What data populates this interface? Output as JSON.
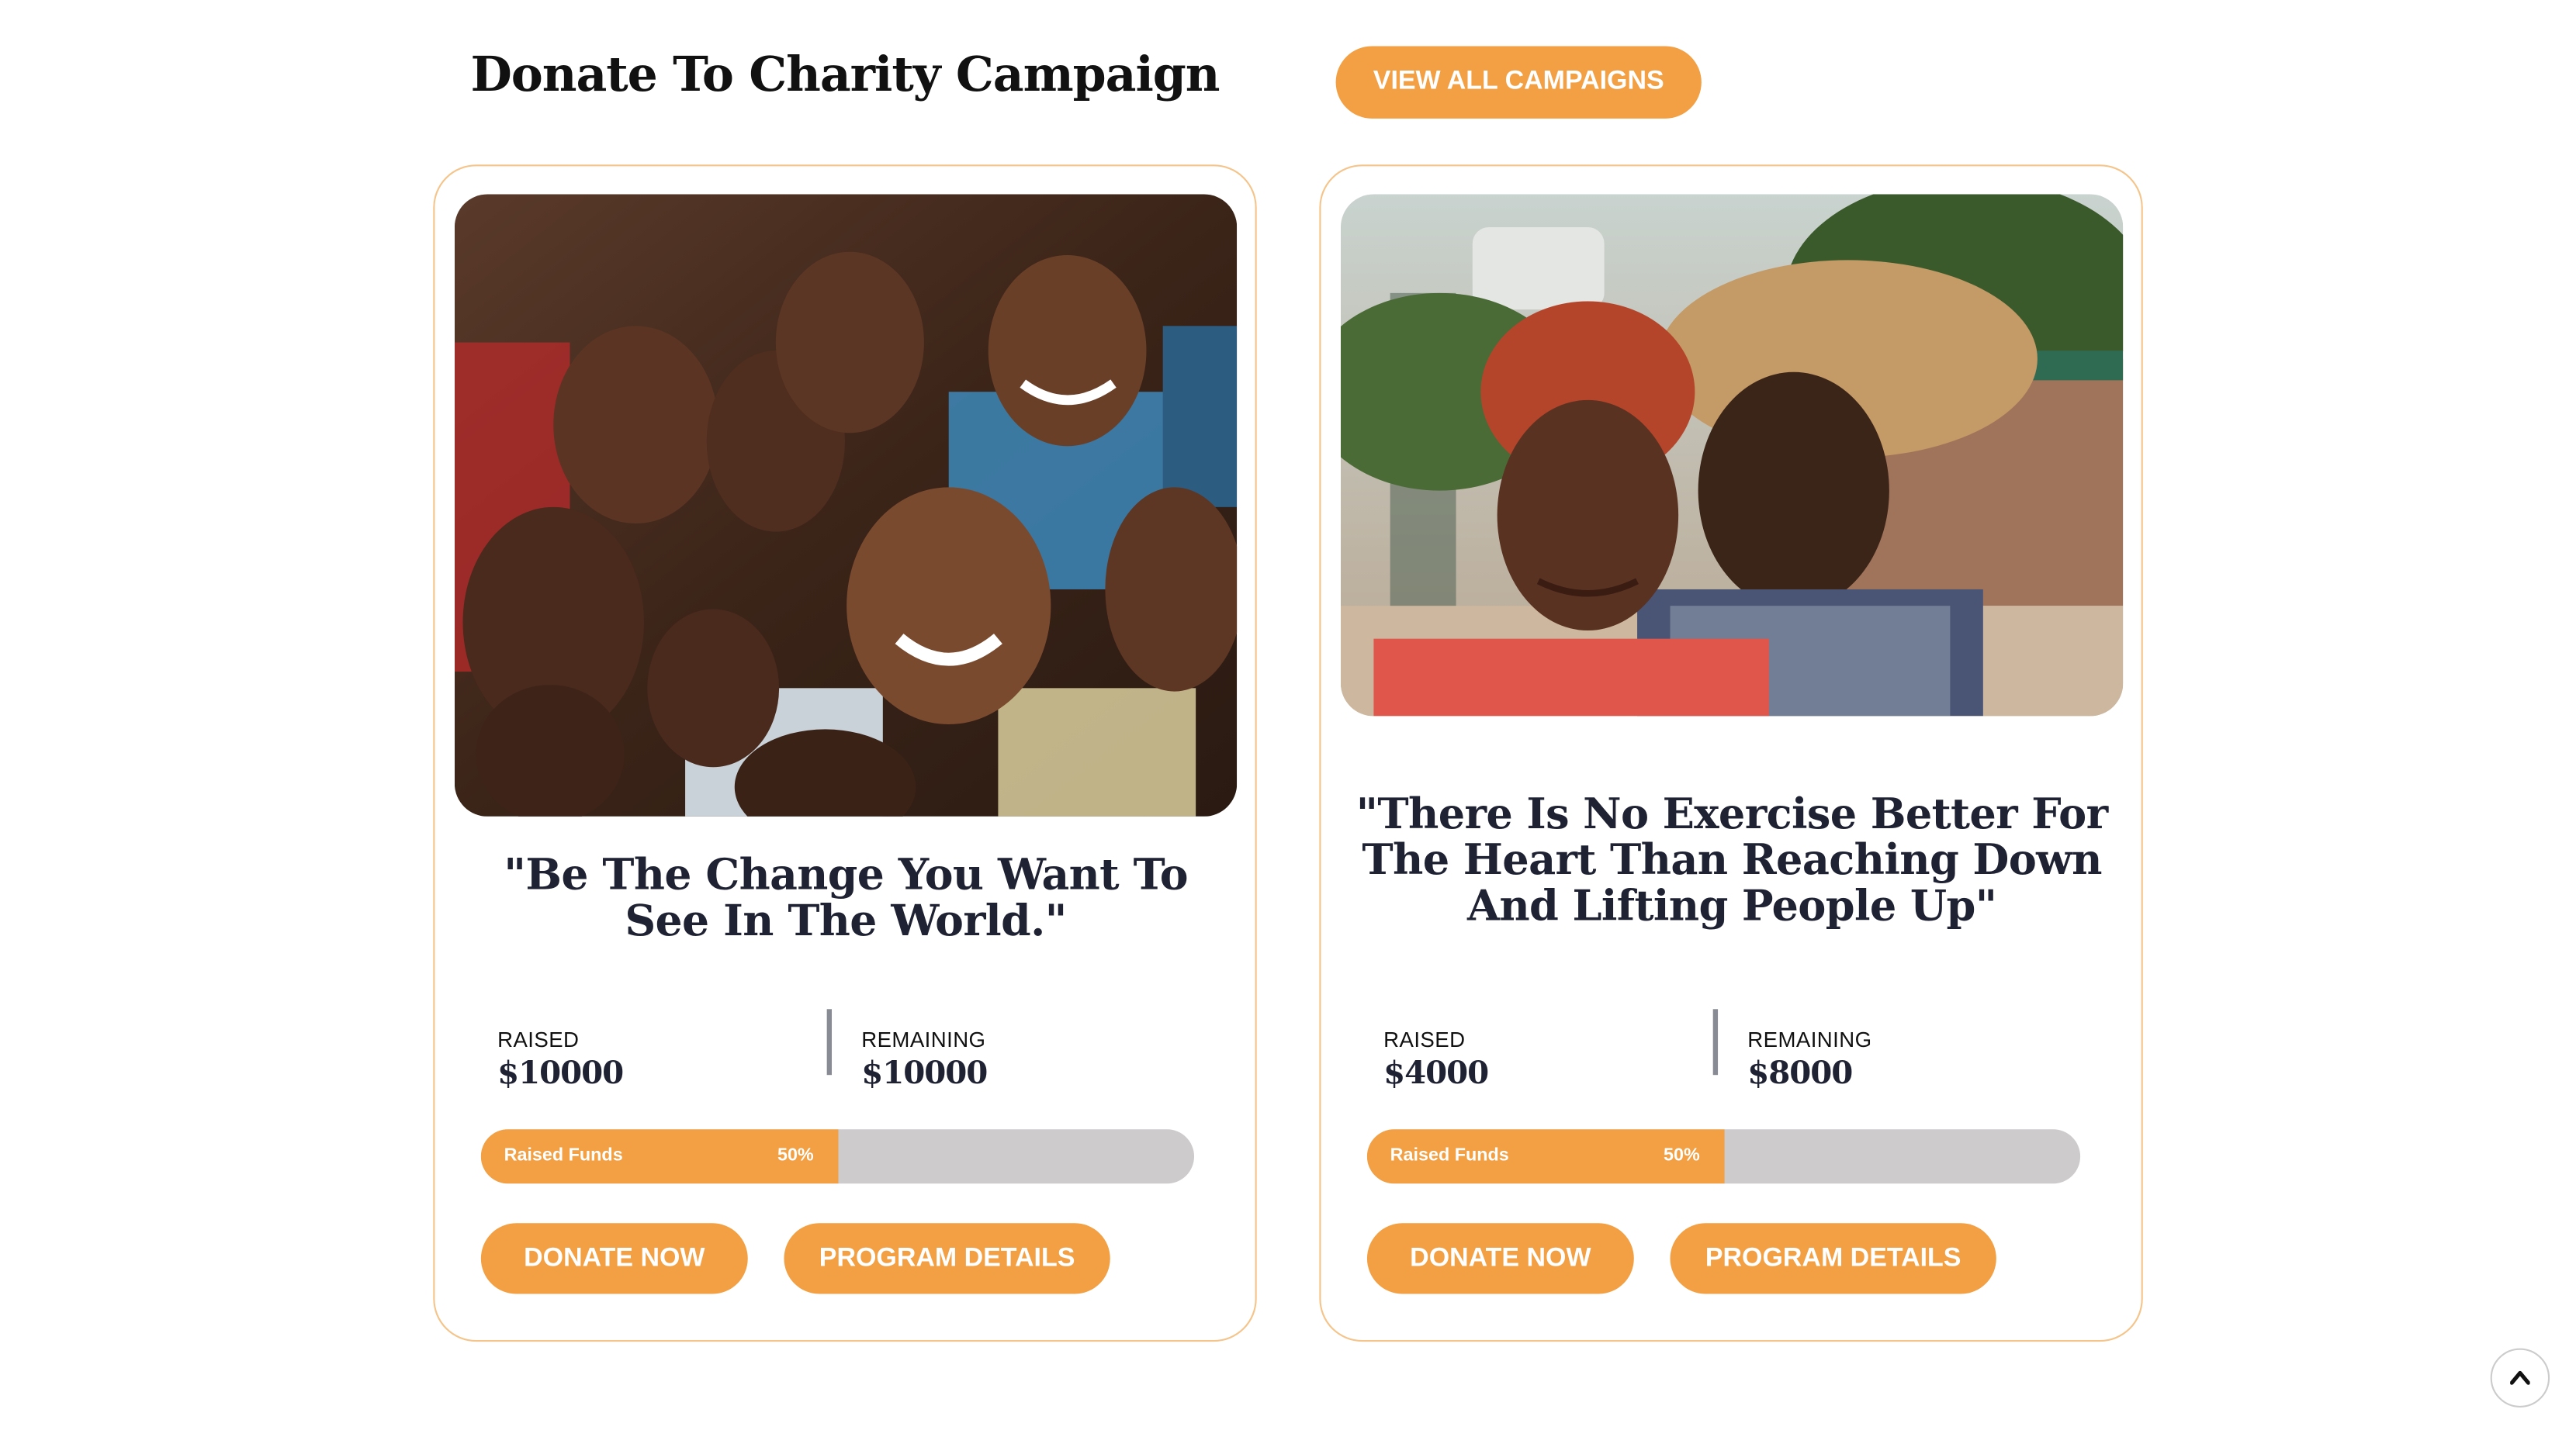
{
  "header": {
    "title": "Donate To Charity Campaign",
    "view_all_label": "VIEW ALL CAMPAIGNS"
  },
  "campaigns": [
    {
      "quote": "\"Be The Change You Want To See In The World.\"",
      "raised_label": "RAISED",
      "raised_value": "$10000",
      "remaining_label": "REMAINING",
      "remaining_value": "$10000",
      "progress_label": "Raised Funds",
      "progress_percent_text": "50%",
      "progress_fraction": 0.5,
      "donate_label": "DONATE NOW",
      "details_label": "PROGRAM DETAILS"
    },
    {
      "quote": "\"There Is No Exercise Better For The Heart Than Reaching Down And Lifting People Up\"",
      "raised_label": "RAISED",
      "raised_value": "$4000",
      "remaining_label": "REMAINING",
      "remaining_value": "$8000",
      "progress_label": "Raised Funds",
      "progress_percent_text": "50%",
      "progress_fraction": 0.5,
      "donate_label": "DONATE NOW",
      "details_label": "PROGRAM DETAILS"
    }
  ],
  "colors": {
    "accent": "#f2a043",
    "track": "#cecbcd",
    "card_border": "#f5c48a",
    "heading": "#1e2233"
  },
  "scroll_top_icon": "chevron-up-icon"
}
